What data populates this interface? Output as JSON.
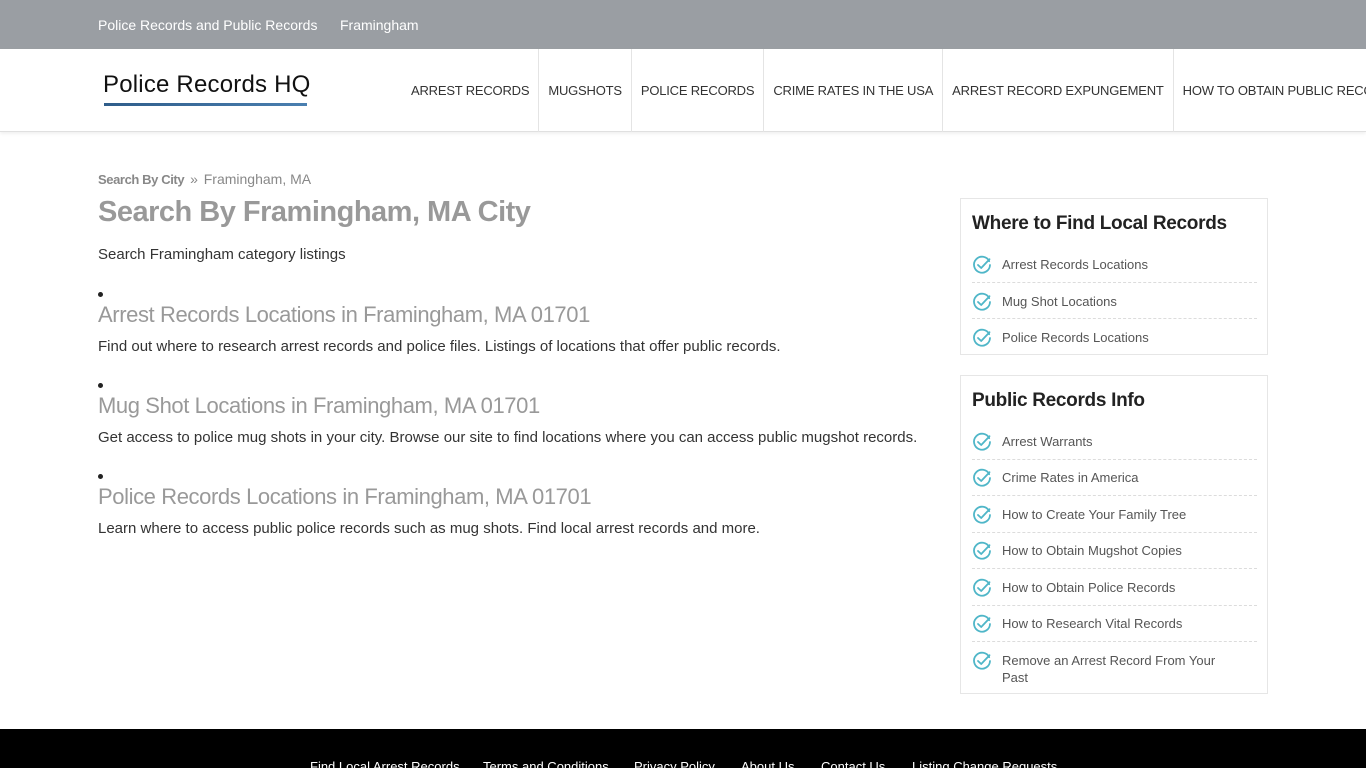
{
  "topbar": {
    "links": [
      "Police Records and Public Records",
      "Framingham"
    ]
  },
  "header": {
    "logo_text": "Police Records HQ",
    "nav": [
      "Arrest Records",
      "Mugshots",
      "Police Records",
      "Crime Rates in the USA",
      "Arrest Record Expungement",
      "How to Obtain Public Records"
    ]
  },
  "breadcrumb": {
    "link": "Search By City",
    "separator": "»",
    "current": "Framingham, MA"
  },
  "main": {
    "title": "Search By Framingham, MA City",
    "intro": "Search Framingham category listings",
    "listings": [
      {
        "title": "Arrest Records Locations in Framingham, MA 01701",
        "desc": "Find out where to research arrest records and police files. Listings of locations that offer public records."
      },
      {
        "title": "Mug Shot Locations in Framingham, MA 01701",
        "desc": "Get access to police mug shots in your city. Browse our site to find locations where you can access public mugshot records."
      },
      {
        "title": "Police Records Locations in Framingham, MA 01701",
        "desc": "Learn where to access public police records such as mug shots. Find local arrest records and more."
      }
    ]
  },
  "sidebar": {
    "local": {
      "title": "Where to Find Local Records",
      "items": [
        "Arrest Records Locations",
        "Mug Shot Locations",
        "Police Records Locations"
      ]
    },
    "info": {
      "title": "Public Records Info",
      "items": [
        "Arrest Warrants",
        "Crime Rates in America",
        "How to Create Your Family Tree",
        "How to Obtain Mugshot Copies",
        "How to Obtain Police Records",
        "How to Research Vital Records",
        "Remove an Arrest Record From Your Past"
      ]
    }
  },
  "footer": {
    "links": [
      "Find Local Arrest Records",
      "Terms and Conditions",
      "Privacy Policy",
      "About Us",
      "Contact Us",
      "Listing Change Requests"
    ]
  },
  "colors": {
    "topbar": "#9a9ea3",
    "check_icon": "#4fb6c8",
    "footer": "#000000"
  }
}
